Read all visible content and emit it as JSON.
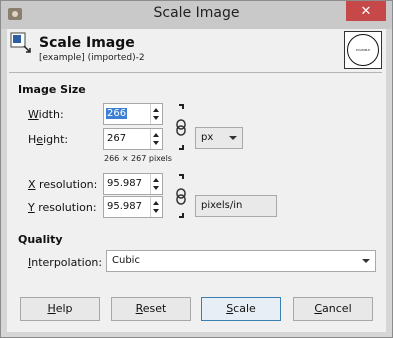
{
  "window": {
    "title": "Scale Image",
    "close_glyph": "✕"
  },
  "header": {
    "title": "Scale Image",
    "subtitle": "[example] (imported)-2",
    "preview_text": "EXAMPLE",
    "icon": "scale-image-icon"
  },
  "image_size": {
    "section_title": "Image Size",
    "width_label": "Width:",
    "width_value": "266",
    "height_label": "Height:",
    "height_value": "267",
    "size_note": "266 × 267 pixels",
    "unit_value": "px",
    "x_res_label": "X resolution:",
    "x_res_value": "95.987",
    "y_res_label": "Y resolution:",
    "y_res_value": "95.987",
    "res_unit_value": "pixels/in"
  },
  "quality": {
    "section_title": "Quality",
    "interpolation_label": "Interpolation:",
    "interpolation_value": "Cubic"
  },
  "buttons": {
    "help": "Help",
    "reset": "Reset",
    "scale": "Scale",
    "cancel": "Cancel"
  },
  "colors": {
    "selection": "#3d7fd3",
    "close": "#c74848"
  }
}
